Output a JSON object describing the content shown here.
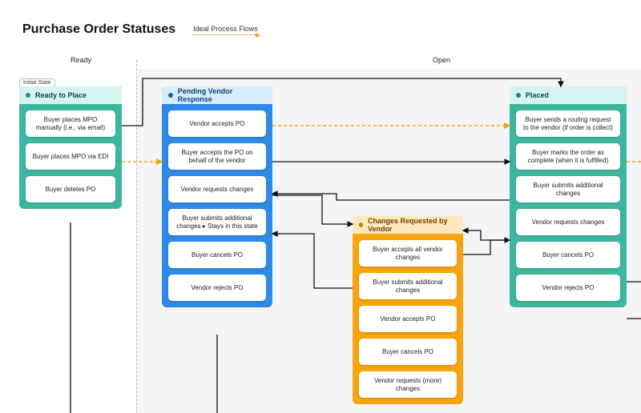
{
  "title": "Purchase Order Statuses",
  "legend": {
    "label": "Ideal Process Flows"
  },
  "zones": {
    "ready": "Ready",
    "open": "Open"
  },
  "initial_badge": "Initial State",
  "lanes": {
    "ready_to_place": {
      "title": "Ready to Place",
      "cards": [
        "Buyer places MPO manually (i.e., via email)",
        "Buyer places MPO via EDI",
        "Buyer deletes PO"
      ]
    },
    "pending_vendor": {
      "title": "Pending Vendor Response",
      "cards": [
        "Vendor accepts PO",
        "Buyer accepts the PO on behalf of the vendor",
        "Vendor requests changes",
        "Buyer submits additional changes ▸ Stays in this state",
        "Buyer cancels PO",
        "Vendor rejects PO"
      ]
    },
    "changes_requested": {
      "title": "Changes Requested by Vendor",
      "cards": [
        "Buyer accepts all vendor changes",
        "Buyer submits additional changes",
        "Vendor accepts PO",
        "Buyer cancels PO",
        "Vendor requests (more) changes"
      ]
    },
    "placed": {
      "title": "Placed",
      "cards": [
        "Buyer sends a routing request to the vendor (if order is collect)",
        "Buyer marks the order as complete (when it is fulfilled)",
        "Buyer submits additional changes",
        "Vendor requests changes",
        "Buyer cancels PO",
        "Vendor rejects PO"
      ]
    }
  }
}
